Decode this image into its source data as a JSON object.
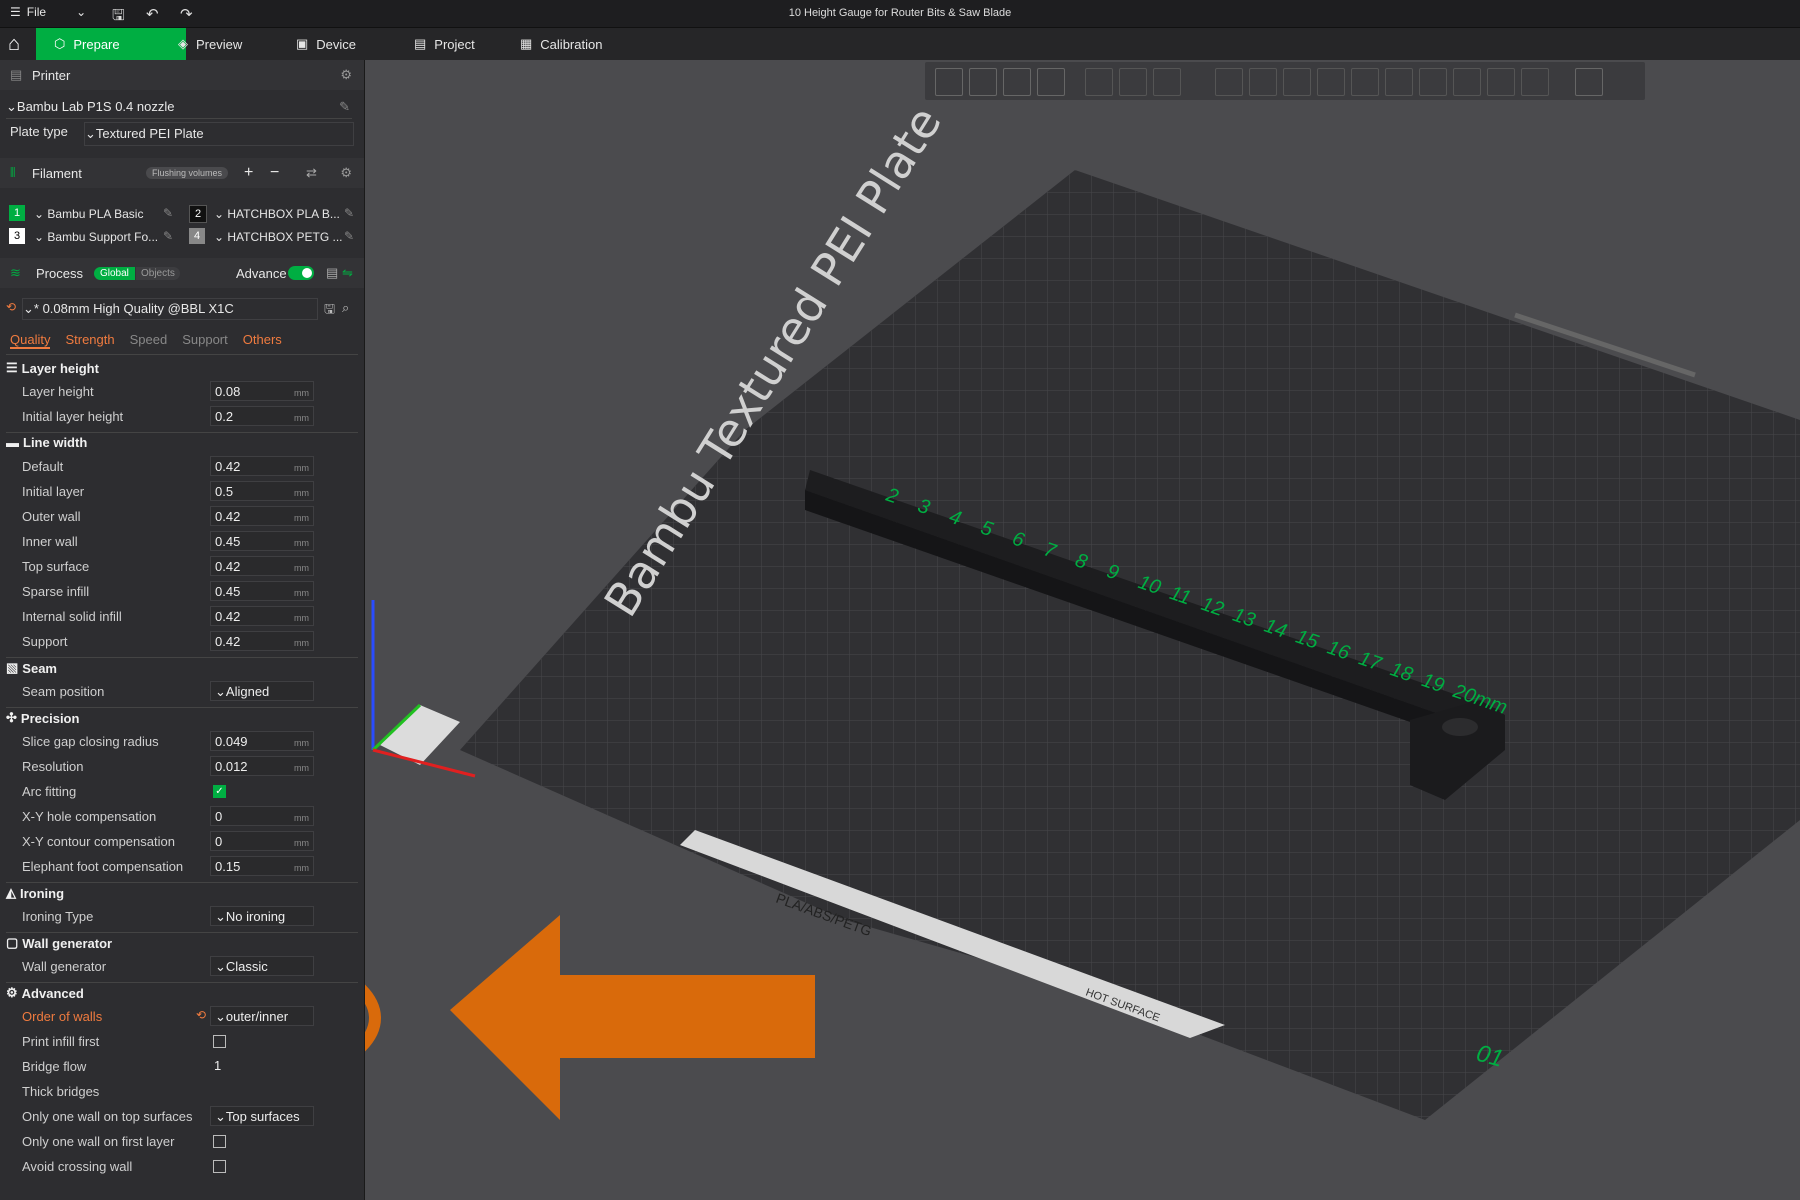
{
  "titlebar": {
    "menu": "File",
    "title": "10 Height Gauge for Router Bits & Saw Blade"
  },
  "tabs": [
    {
      "label": "Prepare"
    },
    {
      "label": "Preview"
    },
    {
      "label": "Device"
    },
    {
      "label": "Project"
    },
    {
      "label": "Calibration"
    }
  ],
  "printer": {
    "header": "Printer",
    "name": "Bambu Lab P1S 0.4 nozzle",
    "plate_label": "Plate type",
    "plate_value": "Textured PEI Plate"
  },
  "filament": {
    "header": "Filament",
    "flushing": "Flushing volumes",
    "items": [
      {
        "num": "1",
        "name": "Bambu PLA Basic",
        "color": "#00ae42"
      },
      {
        "num": "2",
        "name": "HATCHBOX PLA B...",
        "color": "#111111"
      },
      {
        "num": "3",
        "name": "Bambu Support Fo...",
        "color": "#ffffff"
      },
      {
        "num": "4",
        "name": "HATCHBOX PETG ...",
        "color": "#888888"
      }
    ]
  },
  "process": {
    "header": "Process",
    "global": "Global",
    "objects": "Objects",
    "advance": "Advance",
    "preset": "* 0.08mm High Quality @BBL X1C"
  },
  "subtabs": [
    "Quality",
    "Strength",
    "Speed",
    "Support",
    "Others"
  ],
  "groups": {
    "layer_height": "Layer height",
    "line_width": "Line width",
    "seam": "Seam",
    "precision": "Precision",
    "ironing": "Ironing",
    "wall_generator": "Wall generator",
    "advanced": "Advanced"
  },
  "unit": "mm",
  "settings": {
    "layer_height": {
      "label": "Layer height",
      "value": "0.08"
    },
    "initial_layer_height": {
      "label": "Initial layer height",
      "value": "0.2"
    },
    "default": {
      "label": "Default",
      "value": "0.42"
    },
    "initial_layer": {
      "label": "Initial layer",
      "value": "0.5"
    },
    "outer_wall": {
      "label": "Outer wall",
      "value": "0.42"
    },
    "inner_wall": {
      "label": "Inner wall",
      "value": "0.45"
    },
    "top_surface": {
      "label": "Top surface",
      "value": "0.42"
    },
    "sparse_infill": {
      "label": "Sparse infill",
      "value": "0.45"
    },
    "internal_solid_infill": {
      "label": "Internal solid infill",
      "value": "0.42"
    },
    "support": {
      "label": "Support",
      "value": "0.42"
    },
    "seam_position": {
      "label": "Seam position",
      "value": "Aligned"
    },
    "slice_gap": {
      "label": "Slice gap closing radius",
      "value": "0.049"
    },
    "resolution": {
      "label": "Resolution",
      "value": "0.012"
    },
    "arc_fitting": {
      "label": "Arc fitting"
    },
    "xy_hole": {
      "label": "X-Y hole compensation",
      "value": "0"
    },
    "xy_contour": {
      "label": "X-Y contour compensation",
      "value": "0"
    },
    "elephant": {
      "label": "Elephant foot compensation",
      "value": "0.15"
    },
    "ironing_type": {
      "label": "Ironing Type",
      "value": "No ironing"
    },
    "wall_generator": {
      "label": "Wall generator",
      "value": "Classic"
    },
    "order_of_walls": {
      "label": "Order of walls",
      "value": "outer/inner"
    },
    "print_infill_first": {
      "label": "Print infill first"
    },
    "bridge_flow": {
      "label": "Bridge flow",
      "value": "1"
    },
    "thick_bridges": {
      "label": "Thick bridges"
    },
    "one_wall_top": {
      "label": "Only one wall on top surfaces",
      "value": "Top surfaces"
    },
    "one_wall_first": {
      "label": "Only one wall on first layer"
    },
    "avoid_crossing": {
      "label": "Avoid crossing wall"
    }
  },
  "plate": {
    "name": "Bambu Textured PEI Plate",
    "materials": "PLA/ABS/PETG",
    "hot": "HOT SURFACE",
    "num": "01"
  },
  "gauge_numbers": [
    "2",
    "3",
    "4",
    "5",
    "6",
    "7",
    "8",
    "9",
    "10",
    "11",
    "12",
    "13",
    "14",
    "15",
    "16",
    "17",
    "18",
    "19",
    "20mm"
  ],
  "colors": {
    "accent": "#00ae42",
    "highlight": "#d96a0b",
    "label_orange": "#f07b3f"
  }
}
